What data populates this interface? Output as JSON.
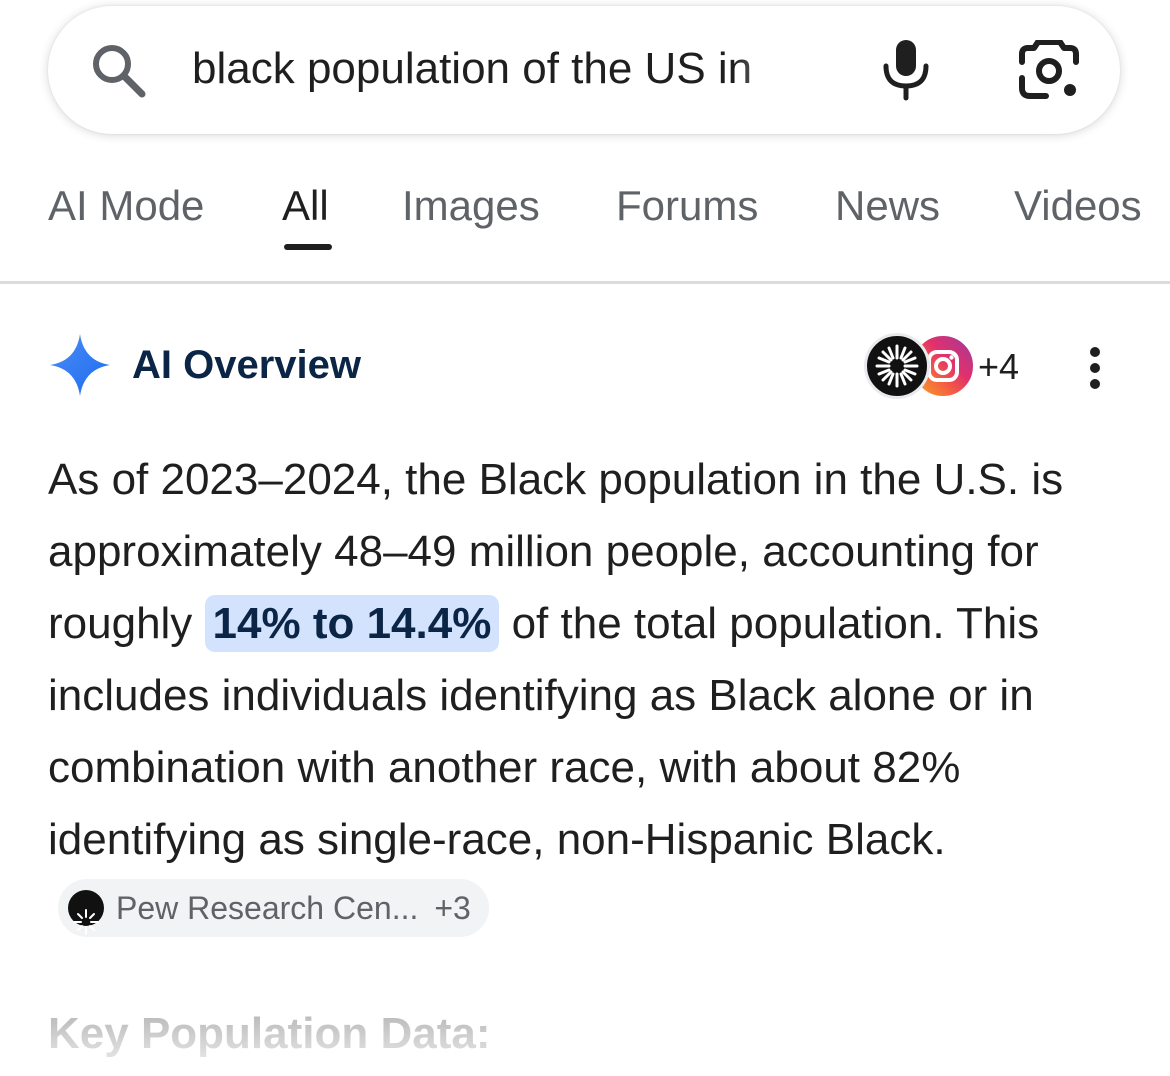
{
  "search": {
    "query": "black population of the US in"
  },
  "tabs": [
    {
      "label": "AI Mode",
      "active": false
    },
    {
      "label": "All",
      "active": true
    },
    {
      "label": "Images",
      "active": false
    },
    {
      "label": "Forums",
      "active": false
    },
    {
      "label": "News",
      "active": false
    },
    {
      "label": "Videos",
      "active": false
    }
  ],
  "ai_overview": {
    "title": "AI Overview",
    "sources_more": "+4",
    "body": {
      "part1": "As of 2023–2024, the Black population in the U.S. is approximately 48–49 million people, accounting for roughly ",
      "highlight": "14% to 14.4%",
      "part2": " of the total population. This includes individuals identifying as Black alone or in combination with another race, with about 82% identifying as single-race, non-Hispanic Black."
    },
    "source_chip": {
      "label": "Pew Research Cen...",
      "count": "+3"
    },
    "next_heading": "Key Population Data:"
  },
  "colors": {
    "accent_blue": "#4285f4",
    "highlight_bg": "#d3e3fd",
    "title_navy": "#0b2546"
  },
  "icons": [
    "search-icon",
    "mic-icon",
    "lens-icon",
    "sparkle-icon",
    "more-vertical-icon"
  ]
}
